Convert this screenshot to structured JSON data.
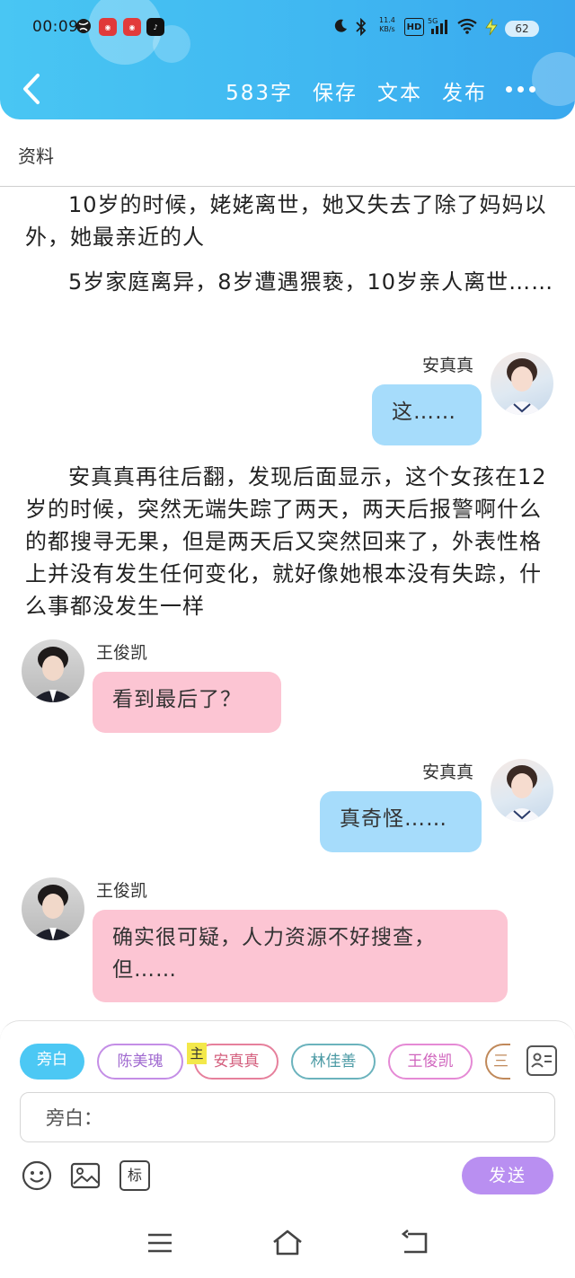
{
  "status_bar": {
    "time": "00:09",
    "network_speed_value": "11.4",
    "network_speed_unit": "KB/s",
    "hd_label": "HD",
    "signal_label": "5G",
    "battery": "62"
  },
  "header": {
    "word_count": "583字",
    "save_label": "保存",
    "text_label": "文本",
    "publish_label": "发布"
  },
  "section": {
    "label": "资料"
  },
  "colors": {
    "header_blue": "#3fb6f1",
    "right_bubble": "#a6dcfb",
    "left_bubble": "#fcc5d3",
    "send_purple": "#b98ff1",
    "narration_chip": "#4cc8f4"
  },
  "feed": {
    "narration_1": "10岁的时候，姥姥离世，她又失去了除了妈妈以外，她最亲近的人",
    "narration_2": "5岁家庭离异，8岁遭遇猥亵，10岁亲人离世……",
    "msg_1": {
      "name": "安真真",
      "text": "这……"
    },
    "narration_3": "安真真再往后翻，发现后面显示，这个女孩在12岁的时候，突然无端失踪了两天，两天后报警啊什么的都搜寻无果，但是两天后又突然回来了，外表性格上并没有发生任何变化，就好像她根本没有失踪，什么事都没发生一样",
    "msg_2": {
      "name": "王俊凯",
      "text": "看到最后了？"
    },
    "msg_3": {
      "name": "安真真",
      "text": "真奇怪……"
    },
    "msg_4": {
      "name": "王俊凯",
      "text": "确实很可疑，人力资源不好搜查，但……"
    }
  },
  "composer": {
    "roles": [
      "旁白",
      "陈美瑰",
      "安真真",
      "林佳善",
      "王俊凯",
      "三"
    ],
    "main_tag": "主",
    "input_value": "旁白：",
    "tag_button": "标",
    "send_label": "发送"
  }
}
